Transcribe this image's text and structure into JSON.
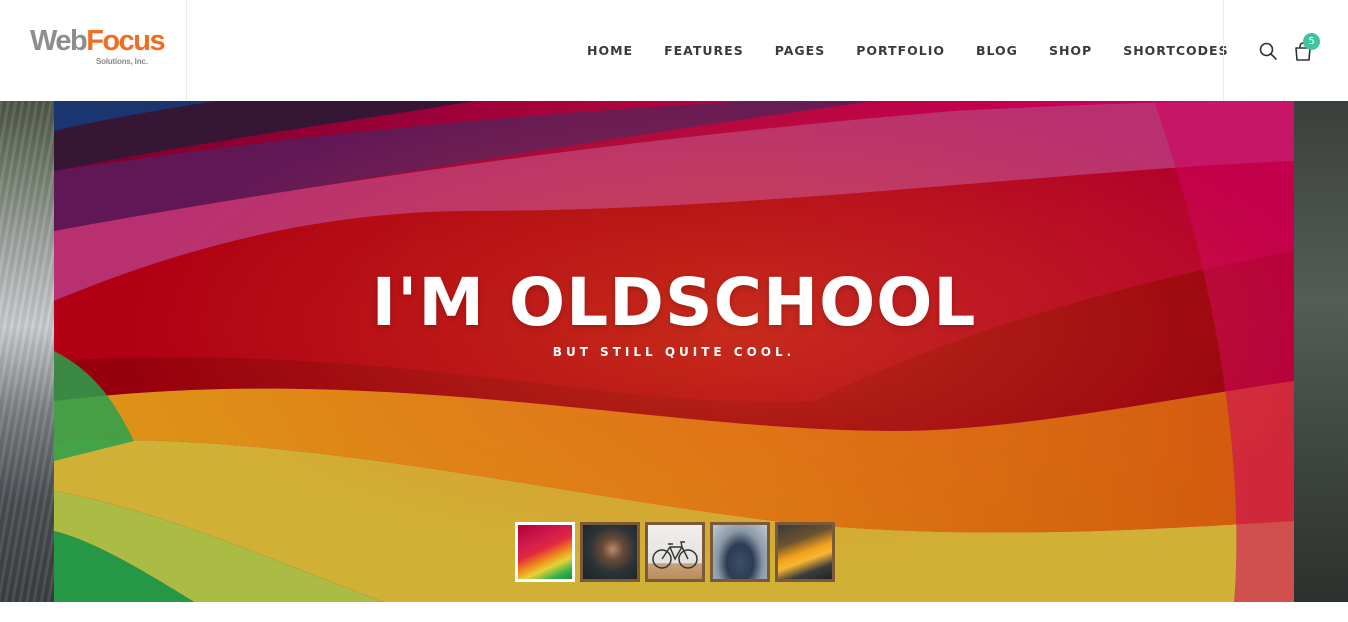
{
  "brand": {
    "name_part1": "Web",
    "name_part2": "Focus",
    "tagline": "Solutions, Inc."
  },
  "nav": {
    "items": [
      {
        "label": "HOME"
      },
      {
        "label": "FEATURES"
      },
      {
        "label": "PAGES"
      },
      {
        "label": "PORTFOLIO"
      },
      {
        "label": "BLOG"
      },
      {
        "label": "SHOP"
      },
      {
        "label": "SHORTCODES"
      }
    ]
  },
  "tools": {
    "search_icon": "search-icon",
    "cart_icon": "shopping-bag-icon",
    "cart_count": "5",
    "cart_badge_color": "#3ec3a4"
  },
  "hero": {
    "title": "I'M OLDSCHOOL",
    "subtitle": "BUT STILL QUITE COOL."
  },
  "slider": {
    "active_index": 0,
    "thumbnails": [
      {
        "name": "colorful-paper-thumb"
      },
      {
        "name": "woman-portrait-thumb"
      },
      {
        "name": "bicycle-thumb"
      },
      {
        "name": "man-back-thumb"
      },
      {
        "name": "yellow-sports-car-thumb"
      }
    ]
  },
  "colors": {
    "brand_gray": "#8d8d8d",
    "brand_orange": "#f26d1f",
    "nav_text": "#3a3a3a"
  }
}
